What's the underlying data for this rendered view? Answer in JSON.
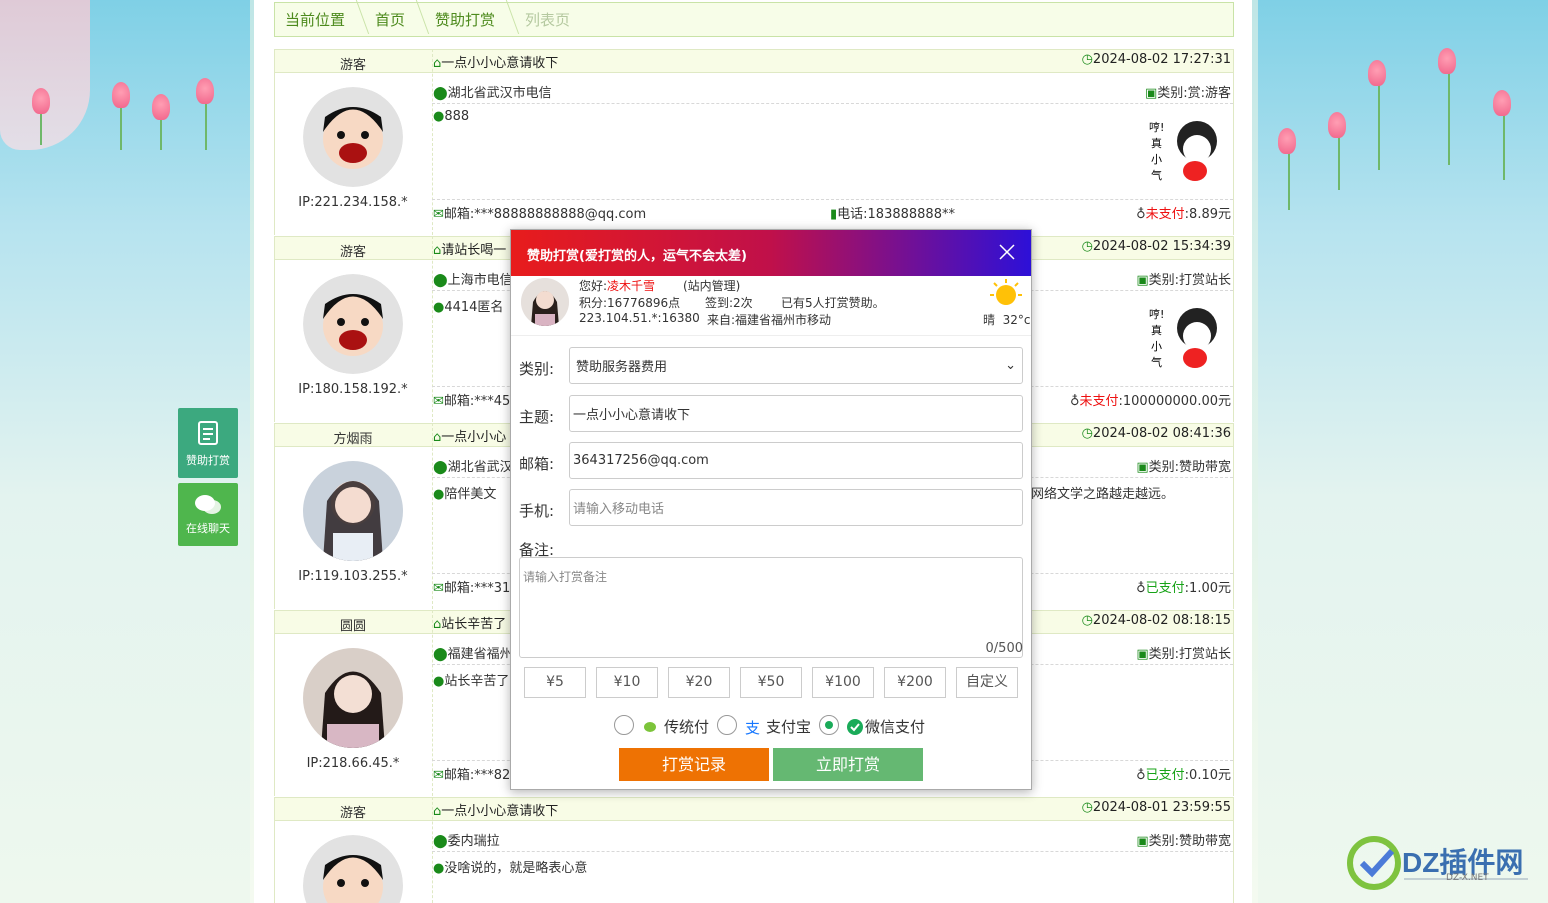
{
  "breadcrumb": [
    "当前位置",
    "首页",
    "赞助打赏",
    "列表页"
  ],
  "records": [
    {
      "name": "游客",
      "title": "一点小小心意请收下",
      "time": "2024-08-02 17:27:31",
      "ip": "IP:221.234.158.*",
      "location": "湖北省武汉市电信",
      "category": "类别:赏:游客",
      "message": "888",
      "email": "邮箱:***88888888888@qq.com",
      "phone": "电话:183888888**",
      "pay_status": "未支付",
      "pay_amount": ":8.89元"
    },
    {
      "name": "游客",
      "title": "请站长喝一",
      "time": "2024-08-02 15:34:39",
      "ip": "IP:180.158.192.*",
      "location": "上海市电信",
      "category": "类别:打赏站长",
      "message": "4414匿名",
      "email": "邮箱:***45",
      "phone": "",
      "pay_status": "未支付",
      "pay_amount": ":100000000.00元"
    },
    {
      "name": "方烟雨",
      "title": "一点小小心",
      "time": "2024-08-02 08:41:36",
      "ip": "IP:119.103.255.*",
      "location": "湖北省武汉",
      "category": "类别:赞助带宽",
      "message": "陪伴美文",
      "message_tail": "网络文学之路越走越远。",
      "email": "邮箱:***31",
      "phone": "",
      "pay_status": "已支付",
      "pay_amount": ":1.00元"
    },
    {
      "name": "圆圆",
      "title": "站长辛苦了",
      "time": "2024-08-02 08:18:15",
      "ip": "IP:218.66.45.*",
      "location": "福建省福州",
      "category": "类别:打赏站长",
      "message": "站长辛苦了",
      "email": "邮箱:***82",
      "phone": "",
      "pay_status": "已支付",
      "pay_amount": ":0.10元"
    },
    {
      "name": "游客",
      "title": "一点小小心意请收下",
      "time": "2024-08-01 23:59:55",
      "ip": "",
      "location": "委内瑞拉",
      "category": "类别:赞助带宽",
      "message": "没啥说的，就是略表心意",
      "email": "",
      "phone": "",
      "pay_status": "",
      "pay_amount": ""
    }
  ],
  "float_buttons": {
    "donate": "赞助打赏",
    "chat": "在线聊天"
  },
  "modal": {
    "title": "赞助打赏(爱打赏的人，运气不会太差)",
    "greeting": "您好:",
    "username": "凌木千雪",
    "role": "(站内管理)",
    "points": "积分:16776896点",
    "signin": "签到:2次",
    "donors": "已有5人打赏赞助。",
    "ip": "223.104.51.*:16380",
    "from": "来自:福建省福州市移动",
    "weather": "晴",
    "temp": "32°c",
    "labels": {
      "category": "类别:",
      "subject": "主题:",
      "email": "邮箱:",
      "phone": "手机:",
      "note": "备注:"
    },
    "category_value": "赞助服务器费用",
    "subject_value": "一点小小心意请收下",
    "email_value": "364317256@qq.com",
    "phone_placeholder": "请输入移动电话",
    "note_placeholder": "请输入打赏备注",
    "counter": "0/500",
    "amounts": [
      "¥5",
      "¥10",
      "¥20",
      "¥50",
      "¥100",
      "¥200",
      "自定义"
    ],
    "methods": [
      {
        "label": "传统付",
        "selected": false
      },
      {
        "label": "支付宝",
        "selected": false
      },
      {
        "label": "微信支付",
        "selected": true
      }
    ],
    "btn_records": "打赏记录",
    "btn_pay": "立即打赏"
  },
  "logo": {
    "brand": "DZ插件网",
    "sub": "DZ-X.NET"
  },
  "colors": {
    "accent_green": "#1a8a1a",
    "unpaid": "#e11111",
    "paid": "#17a317",
    "header_from": "#e81c1c",
    "header_to": "#2d10d8",
    "btn_orange": "#ee7203",
    "btn_green": "#65b872"
  }
}
